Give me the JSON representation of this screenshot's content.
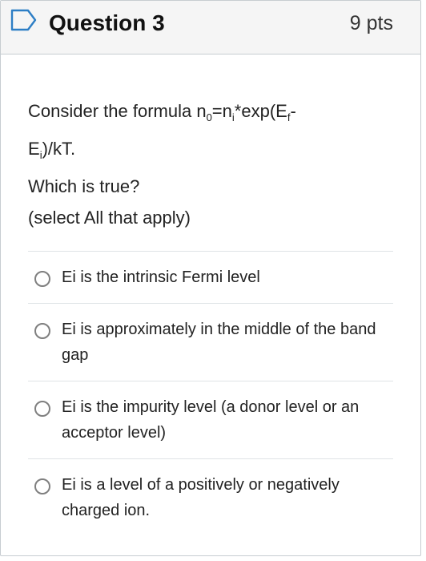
{
  "header": {
    "title": "Question 3",
    "points": "9 pts",
    "flag_icon": "bookmark-outline-icon",
    "accent_color": "#2d7ec5"
  },
  "question": {
    "line1_prefix": "Consider the formula n",
    "line1_sub0": "0",
    "line1_mid": "=n",
    "line1_sub_i": "i",
    "line1_exp": "*exp(E",
    "line1_sub_f": "f",
    "line1_suffix": "-",
    "line2_prefix": "E",
    "line2_sub_i": "i",
    "line2_suffix": ")/kT.",
    "line3": "Which is true?",
    "line4": "(select All that apply)"
  },
  "answers": [
    {
      "label": "Ei is the intrinsic Fermi level"
    },
    {
      "label": "Ei is approximately in the middle of the band gap"
    },
    {
      "label": "Ei is the impurity level (a donor level or an acceptor level)"
    },
    {
      "label": "Ei is a level of a positively or negatively charged ion."
    }
  ]
}
